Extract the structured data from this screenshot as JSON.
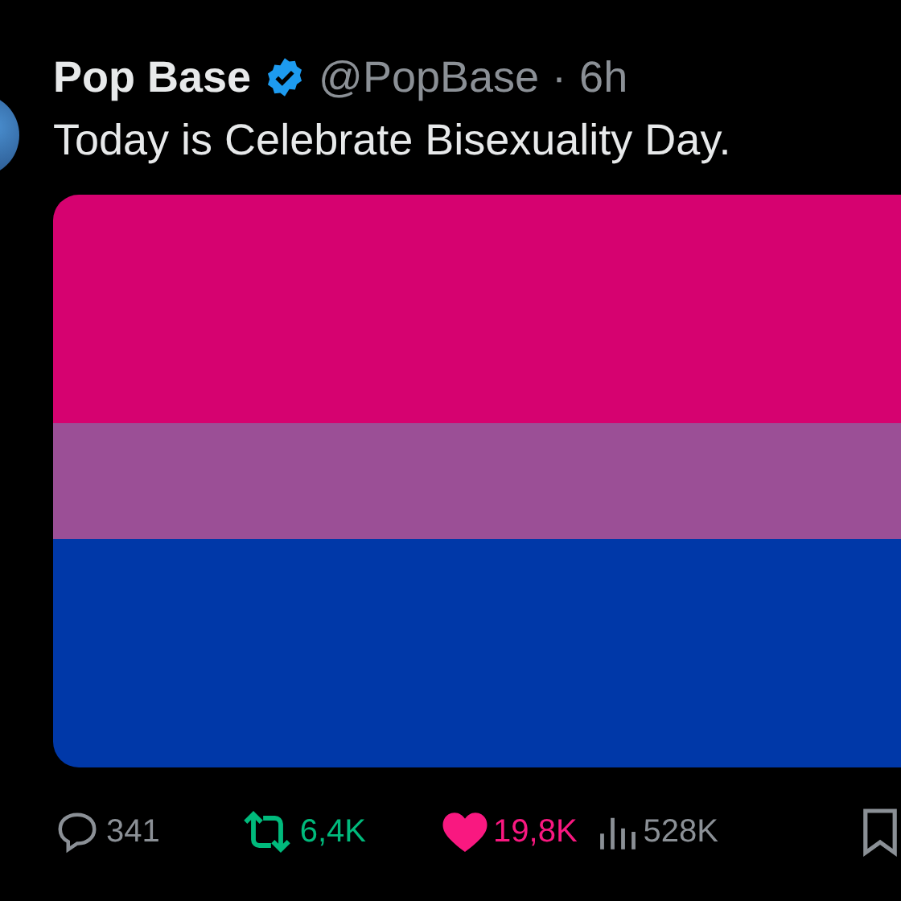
{
  "post": {
    "author": "Pop Base",
    "verified": true,
    "handle": "@PopBase",
    "separator": "·",
    "time": "6h",
    "text": "Today is Celebrate Bisexuality Day.",
    "media": {
      "kind": "flag",
      "stripes": [
        {
          "color": "#d60270"
        },
        {
          "color": "#9b4f96"
        },
        {
          "color": "#0038a8"
        }
      ]
    },
    "actions": [
      {
        "kind": "reply",
        "count": "341",
        "selected": false
      },
      {
        "kind": "repost",
        "count": "6,4K",
        "selected": true
      },
      {
        "kind": "like",
        "count": "19,8K",
        "selected": true
      },
      {
        "kind": "views",
        "count": "528K",
        "selected": false
      },
      {
        "kind": "bookmark",
        "selected": false
      }
    ]
  }
}
